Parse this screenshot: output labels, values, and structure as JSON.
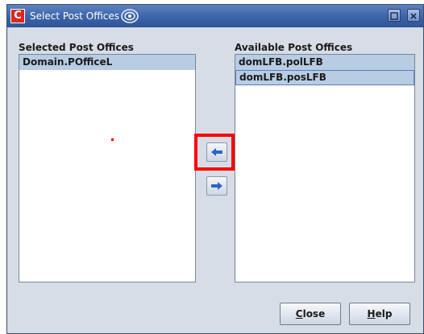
{
  "window": {
    "title": "Select Post Offices",
    "app_icon_letter": "C"
  },
  "left_panel": {
    "heading": "Selected Post Offices",
    "items": [
      {
        "label": "Domain.POfficeL",
        "selected": true
      }
    ]
  },
  "right_panel": {
    "heading": "Available Post Offices",
    "items": [
      {
        "label": "domLFB.polLFB",
        "selected": true
      },
      {
        "label": "domLFB.posLFB",
        "selected": true,
        "focused": true
      }
    ]
  },
  "transfer_buttons": {
    "add": {
      "icon": "arrow-left-icon",
      "highlighted": true
    },
    "remove": {
      "icon": "arrow-right-icon"
    }
  },
  "footer": {
    "close_mnemonic": "C",
    "close_rest": "lose",
    "help_mnemonic": "H",
    "help_rest": "elp"
  },
  "colors": {
    "title_bar": "#3c63a8",
    "selection": "#b8cce4",
    "highlight_box": "#ff0000",
    "arrow": "#2b66c7"
  }
}
